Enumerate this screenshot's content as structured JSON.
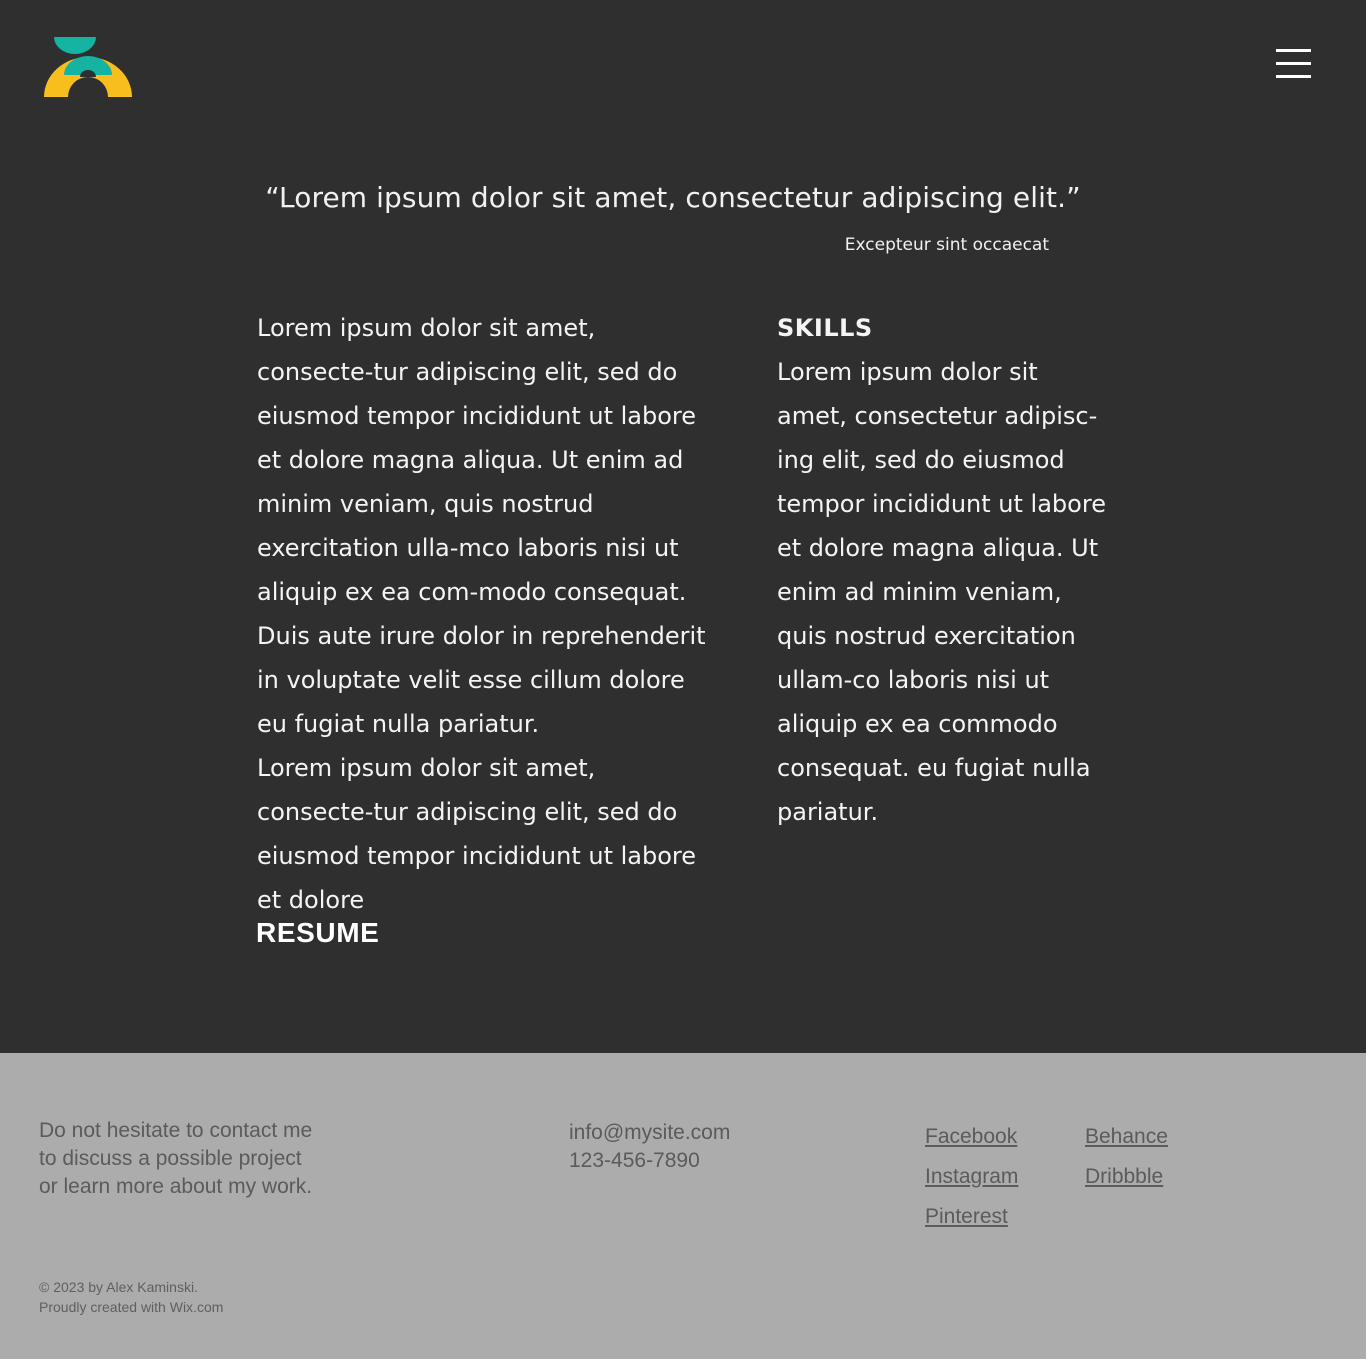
{
  "colors": {
    "background": "#2f2f2f",
    "footer_background": "#acacac",
    "logo_yellow": "#f8be1e",
    "logo_teal": "#15b3a1",
    "text_light": "#f4f4f4",
    "footer_text": "#5b5b5b"
  },
  "header": {
    "logo_icon": "logo-mark-icon",
    "menu_icon": "hamburger-menu-icon"
  },
  "quote": {
    "text": "“Lorem ipsum dolor sit amet, consectetur adipiscing elit.”",
    "author": "Excepteur sint occaecat"
  },
  "main": {
    "paragraph_1": "Lorem ipsum dolor sit amet, consecte-tur adipiscing elit, sed do eiusmod tempor incididunt ut labore et dolore magna aliqua. Ut enim ad minim veniam, quis nostrud exercitation ulla-mco laboris nisi ut aliquip ex ea com-modo consequat. Duis aute irure dolor in reprehenderit in voluptate velit esse cillum dolore eu fugiat nulla pariatur.",
    "paragraph_2": "Lorem ipsum dolor sit amet, consecte-tur adipiscing elit, sed do eiusmod tempor incididunt ut labore et dolore",
    "resume_link": "RESUME"
  },
  "skills": {
    "heading": "SKILLS",
    "text": "Lorem ipsum dolor sit amet, consectetur adipisc-ing elit, sed do eiusmod tempor incididunt ut labore et dolore magna aliqua. Ut enim ad minim veniam, quis nostrud exercitation ullam-co laboris nisi ut aliquip ex ea commodo consequat.  eu fugiat nulla pariatur."
  },
  "footer": {
    "blurb": "Do not hesitate to contact me to discuss a possible project or learn more about my work.",
    "email": "info@mysite.com",
    "phone": "123-456-7890",
    "social": {
      "facebook": "Facebook",
      "instagram": "Instagram",
      "pinterest": "Pinterest",
      "behance": "Behance",
      "dribbble": "Dribbble"
    },
    "copyright": "© 2023 by Alex Kaminski.",
    "credit": "Proudly created with Wix.com"
  }
}
